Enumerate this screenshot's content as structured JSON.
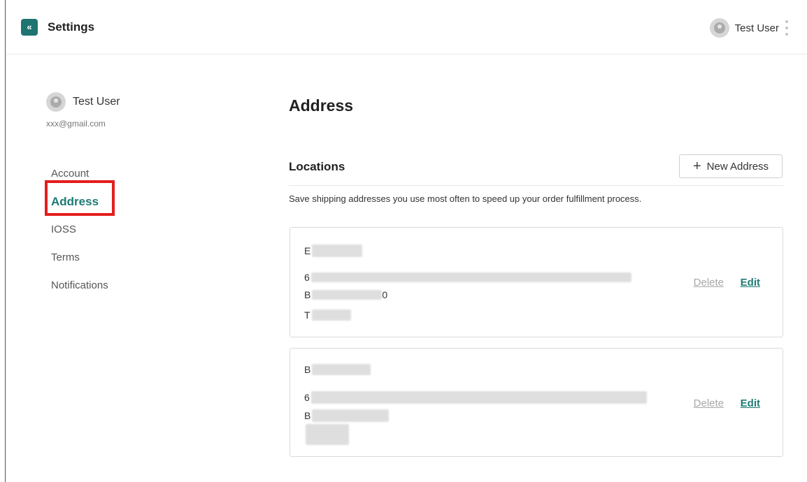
{
  "header": {
    "collapse_icon": "double-chevron-left-icon",
    "title": "Settings",
    "user_name": "Test User",
    "menu_icon": "kebab-menu-icon"
  },
  "sidebar": {
    "profile": {
      "name": "Test User",
      "email": "xxx@gmail.com"
    },
    "items": [
      {
        "label": "Account",
        "active": false
      },
      {
        "label": "Address",
        "active": true
      },
      {
        "label": "IOSS",
        "active": false
      },
      {
        "label": "Terms",
        "active": false
      },
      {
        "label": "Notifications",
        "active": false
      }
    ]
  },
  "main": {
    "title": "Address",
    "section_title": "Locations",
    "new_button_label": "New Address",
    "description": "Save shipping addresses you use most often to speed up your order fulfillment process.",
    "addresses": [
      {
        "line1": "E",
        "line2": "6",
        "line3": "B",
        "line3_end": "0",
        "line4": "T"
      },
      {
        "line1": "B",
        "line2": "6",
        "line3": "B",
        "line3_end": "",
        "line4": ""
      }
    ],
    "delete_label": "Delete",
    "edit_label": "Edit"
  },
  "colors": {
    "accent": "#1e7b73",
    "highlight": "#e41d1d",
    "muted": "#a8a8a8"
  }
}
